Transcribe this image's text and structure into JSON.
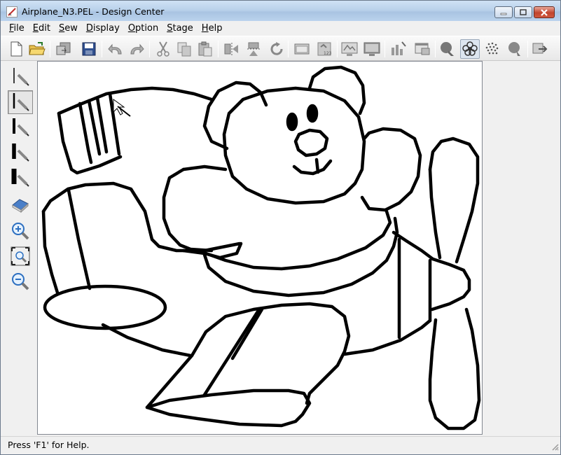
{
  "window": {
    "title": "Airplane_N3.PEL - Design Center"
  },
  "menubar": {
    "items": [
      {
        "id": "file",
        "label": "File",
        "mnemonic": "F",
        "rest": "ile"
      },
      {
        "id": "edit",
        "label": "Edit",
        "mnemonic": "E",
        "rest": "dit"
      },
      {
        "id": "sew",
        "label": "Sew",
        "mnemonic": "S",
        "rest": "ew"
      },
      {
        "id": "display",
        "label": "Display",
        "mnemonic": "D",
        "rest": "isplay"
      },
      {
        "id": "option",
        "label": "Option",
        "mnemonic": "O",
        "rest": "ption"
      },
      {
        "id": "stage",
        "label": "Stage",
        "mnemonic": "S",
        "rest": "tage"
      },
      {
        "id": "help",
        "label": "Help",
        "mnemonic": "H",
        "rest": "elp"
      }
    ]
  },
  "toolbar": {
    "buttons": [
      "new-file-icon",
      "open-folder-icon",
      "import-icon",
      "save-disk-icon",
      "undo-icon",
      "redo-icon",
      "cut-scissors-icon",
      "copy-icon",
      "paste-icon",
      "flip-horizontal-icon",
      "flip-vertical-icon",
      "rotate-icon",
      "design-page-icon",
      "numbered-page-icon",
      "stage-view-icon",
      "monitor-icon",
      "sew-settings-icon",
      "window-icon",
      "outline-stage-icon",
      "flower-stitch-icon",
      "stipple-icon",
      "fill-stage-icon",
      "export-icon"
    ]
  },
  "palette": {
    "tools": [
      "pen-thin-icon",
      "pen-medium-icon",
      "pen-thick-icon",
      "pen-thicker-icon",
      "pen-thickest-icon",
      "eraser-icon",
      "zoom-in-icon",
      "zoom-fit-icon",
      "zoom-out-icon"
    ],
    "selected_tool": "pen-medium-icon"
  },
  "statusbar": {
    "text": "Press 'F1' for Help."
  }
}
